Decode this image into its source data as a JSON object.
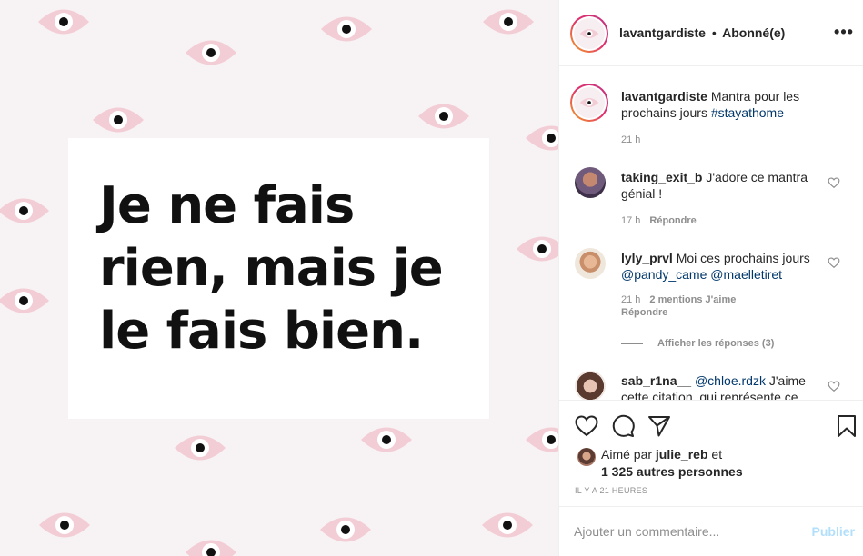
{
  "post": {
    "mantra_lines": [
      "Je ne fais",
      "rien, mais je",
      "le fais bien."
    ]
  },
  "header": {
    "username": "lavantgardiste",
    "separator": "•",
    "follow_status": "Abonné(e)",
    "more_icon": "more-horizontal-icon"
  },
  "caption": {
    "username": "lavantgardiste",
    "text": "Mantra pour les prochains jours",
    "hashtag": "#stayathome",
    "time": "21 h"
  },
  "comments": [
    {
      "username": "taking_exit_b",
      "text": "J'adore ce mantra génial !",
      "time": "17 h",
      "reply_label": "Répondre"
    },
    {
      "username": "lyly_prvl",
      "text": "Moi ces prochains jours",
      "mention1": "@pandy_came",
      "mention2": "@maelletiret",
      "time": "21 h",
      "likes_label": "2 mentions J'aime",
      "reply_label": "Répondre",
      "view_replies": "Afficher les réponses (3)"
    },
    {
      "username": "sab_r1na__",
      "mention": "@chloe.rdzk",
      "text": "J'aime cette citation, qui représente ce"
    }
  ],
  "actions": {
    "like_icon": "heart-icon",
    "comment_icon": "comment-icon",
    "share_icon": "send-icon",
    "save_icon": "bookmark-icon"
  },
  "likes": {
    "prefix": "Aimé par",
    "user": "julie_reb",
    "joiner": "et",
    "others": "1 325 autres personnes"
  },
  "date": "IL Y A 21 HEURES",
  "add_comment": {
    "placeholder": "Ajouter un commentaire...",
    "publish": "Publier"
  },
  "colors": {
    "eye_pink": "#f3cdd5",
    "link_blue": "#00376b",
    "publish_disabled": "#b2dffc",
    "ring_gradient": [
      "#f5a623",
      "#e1306c",
      "#c13584"
    ]
  }
}
